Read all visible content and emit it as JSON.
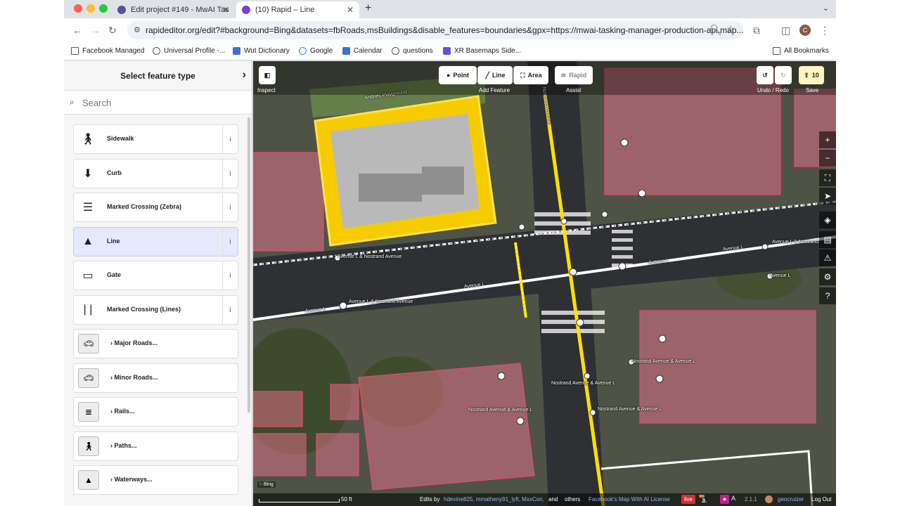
{
  "browser": {
    "tabs": [
      {
        "title": "Edit project #149 - MwAI Tas",
        "active": false
      },
      {
        "title": "(10) Rapid – Line",
        "active": true
      }
    ],
    "url": "rapideditor.org/edit?#background=Bing&datasets=fbRoads,msBuildings&disable_features=boundaries&gpx=https://mwai-tasking-manager-production-api.map...",
    "avatar_letter": "C",
    "bookmarks": [
      "Facebook Managed",
      "Universal Profile -...",
      "Wut Dictionary",
      "Google",
      "Calendar",
      "questions",
      "XR Basemaps Side..."
    ],
    "all_bookmarks": "All Bookmarks",
    "colors": {
      "tabbar": "#dfe3e8",
      "bookmark_icon_blue": "#3b6fd6",
      "bookmark_icon_purple": "#6a4fd6"
    }
  },
  "sidebar": {
    "title": "Select feature type",
    "search_placeholder": "Search",
    "presets": [
      {
        "label": "Sidewalk",
        "icon": "pedestrian-icon"
      },
      {
        "label": "Curb",
        "icon": "curb-icon"
      },
      {
        "label": "Marked Crossing (Zebra)",
        "icon": "zebra-crossing-icon"
      },
      {
        "label": "Line",
        "icon": "line-icon",
        "selected": true
      },
      {
        "label": "Gate",
        "icon": "gate-icon"
      },
      {
        "label": "Marked Crossing (Lines)",
        "icon": "lines-crossing-icon"
      }
    ],
    "categories": [
      {
        "label": "Major Roads...",
        "icon": "car-icon"
      },
      {
        "label": "Minor Roads...",
        "icon": "car-icon"
      },
      {
        "label": "Rails...",
        "icon": "rail-icon"
      },
      {
        "label": "Paths...",
        "icon": "pedestrian-icon"
      },
      {
        "label": "Waterways...",
        "icon": "waterway-icon"
      }
    ],
    "info_glyph": "i"
  },
  "toolbar": {
    "inspect": "Inspect",
    "point": "Point",
    "line": "Line",
    "area": "Area",
    "add_feature": "Add Feature",
    "rapid": "Rapid",
    "assist": "Assist",
    "undo_redo": "Undo / Redo",
    "save_count": "10",
    "save": "Save"
  },
  "map": {
    "labels": [
      "Andries Playground",
      "Nostrand Avenue",
      "Avenue L & Nostrand Avenue",
      "Avenue L",
      "Avenue L & Nostrand Avenue",
      "Avenue L",
      "Avenue L",
      "Avenue L",
      "Avenue L & Nostrand",
      "Avenue L",
      "Nostrand Avenue & Avenue L",
      "Nostrand Avenue & Avenue L",
      "Nostrand Avenue & Avenue L",
      "Nostrand Avenue & Avenue L"
    ],
    "bing": "Bing",
    "scale": "50 ft",
    "edits_prefix": "Edits by",
    "editors": "hdevine825, mmatheny91_lyft, MxxCon,",
    "and": "and",
    "others": "others",
    "license": "Facebook's Map With AI License",
    "live": "live",
    "issues": "3",
    "version": "2.1.1",
    "user": "geocruizer",
    "logout": "Log Out",
    "colors": {
      "selection": "#ffd400",
      "building": "rgba(255,120,150,0.45)",
      "road": "#ffffff",
      "accent": "#3b6fd6"
    }
  }
}
